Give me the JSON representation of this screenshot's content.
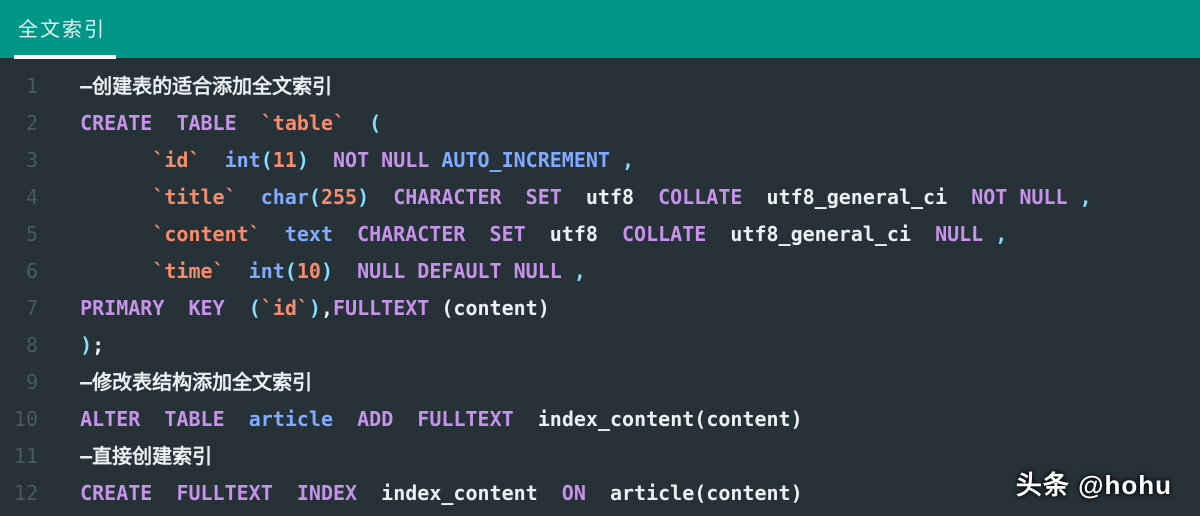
{
  "header": {
    "tab_label": "全文索引"
  },
  "editor": {
    "lines": [
      {
        "num": "1",
        "tokens": [
          [
            "white",
            "  –创建表的适合添加全文索引"
          ]
        ]
      },
      {
        "num": "2",
        "tokens": [
          [
            "white",
            "  "
          ],
          [
            "kw",
            "CREATE"
          ],
          [
            "white",
            "  "
          ],
          [
            "kw",
            "TABLE"
          ],
          [
            "white",
            "  "
          ],
          [
            "str",
            "`table`"
          ],
          [
            "white",
            "  "
          ],
          [
            "punct",
            "("
          ]
        ]
      },
      {
        "num": "3",
        "tokens": [
          [
            "white",
            "        "
          ],
          [
            "str",
            "`id`"
          ],
          [
            "white",
            "  "
          ],
          [
            "type",
            "int"
          ],
          [
            "punct",
            "("
          ],
          [
            "num",
            "11"
          ],
          [
            "punct",
            ")"
          ],
          [
            "white",
            "  "
          ],
          [
            "kw",
            "NOT"
          ],
          [
            "white",
            " "
          ],
          [
            "kw",
            "NULL"
          ],
          [
            "white",
            " "
          ],
          [
            "ident",
            "AUTO_INCREMENT"
          ],
          [
            "white",
            " "
          ],
          [
            "punct",
            ","
          ]
        ]
      },
      {
        "num": "4",
        "tokens": [
          [
            "white",
            "        "
          ],
          [
            "str",
            "`title`"
          ],
          [
            "white",
            "  "
          ],
          [
            "type",
            "char"
          ],
          [
            "punct",
            "("
          ],
          [
            "num",
            "255"
          ],
          [
            "punct",
            ")"
          ],
          [
            "white",
            "  "
          ],
          [
            "kw",
            "CHARACTER"
          ],
          [
            "white",
            "  "
          ],
          [
            "kw",
            "SET"
          ],
          [
            "white",
            "  "
          ],
          [
            "white",
            "utf8  "
          ],
          [
            "kw",
            "COLLATE"
          ],
          [
            "white",
            "  utf8_general_ci  "
          ],
          [
            "kw",
            "NOT"
          ],
          [
            "white",
            " "
          ],
          [
            "kw",
            "NULL"
          ],
          [
            "white",
            " "
          ],
          [
            "punct",
            ","
          ]
        ]
      },
      {
        "num": "5",
        "tokens": [
          [
            "white",
            "        "
          ],
          [
            "str",
            "`content`"
          ],
          [
            "white",
            "  "
          ],
          [
            "type",
            "text"
          ],
          [
            "white",
            "  "
          ],
          [
            "kw",
            "CHARACTER"
          ],
          [
            "white",
            "  "
          ],
          [
            "kw",
            "SET"
          ],
          [
            "white",
            "  utf8  "
          ],
          [
            "kw",
            "COLLATE"
          ],
          [
            "white",
            "  utf8_general_ci  "
          ],
          [
            "kw",
            "NULL"
          ],
          [
            "white",
            " "
          ],
          [
            "punct",
            ","
          ]
        ]
      },
      {
        "num": "6",
        "tokens": [
          [
            "white",
            "        "
          ],
          [
            "str",
            "`time`"
          ],
          [
            "white",
            "  "
          ],
          [
            "type",
            "int"
          ],
          [
            "punct",
            "("
          ],
          [
            "num",
            "10"
          ],
          [
            "punct",
            ")"
          ],
          [
            "white",
            "  "
          ],
          [
            "kw",
            "NULL"
          ],
          [
            "white",
            " "
          ],
          [
            "kw",
            "DEFAULT"
          ],
          [
            "white",
            " "
          ],
          [
            "kw",
            "NULL"
          ],
          [
            "white",
            " "
          ],
          [
            "punct",
            ","
          ]
        ]
      },
      {
        "num": "7",
        "tokens": [
          [
            "white",
            "  "
          ],
          [
            "kw",
            "PRIMARY"
          ],
          [
            "white",
            "  "
          ],
          [
            "kw",
            "KEY"
          ],
          [
            "white",
            "  "
          ],
          [
            "punct",
            "("
          ],
          [
            "str",
            "`id`"
          ],
          [
            "punct",
            ")"
          ],
          [
            "white",
            ","
          ],
          [
            "kw",
            "FULLTEXT"
          ],
          [
            "white",
            " (content)"
          ]
        ]
      },
      {
        "num": "8",
        "tokens": [
          [
            "white",
            "  "
          ],
          [
            "punct",
            ")"
          ],
          [
            "white",
            ";"
          ]
        ]
      },
      {
        "num": "9",
        "tokens": [
          [
            "white",
            "  –修改表结构添加全文索引"
          ]
        ]
      },
      {
        "num": "10",
        "tokens": [
          [
            "white",
            "  "
          ],
          [
            "kw",
            "ALTER"
          ],
          [
            "white",
            "  "
          ],
          [
            "kw",
            "TABLE"
          ],
          [
            "white",
            "  "
          ],
          [
            "ident",
            "article"
          ],
          [
            "white",
            "  "
          ],
          [
            "kw",
            "ADD"
          ],
          [
            "white",
            "  "
          ],
          [
            "kw",
            "FULLTEXT"
          ],
          [
            "white",
            "  index_content(content)"
          ]
        ]
      },
      {
        "num": "11",
        "tokens": [
          [
            "white",
            "  –直接创建索引"
          ]
        ]
      },
      {
        "num": "12",
        "tokens": [
          [
            "white",
            "  "
          ],
          [
            "kw",
            "CREATE"
          ],
          [
            "white",
            "  "
          ],
          [
            "kw",
            "FULLTEXT"
          ],
          [
            "white",
            "  "
          ],
          [
            "kw",
            "INDEX"
          ],
          [
            "white",
            "  index_content  "
          ],
          [
            "kw",
            "ON"
          ],
          [
            "white",
            "  article(content)"
          ]
        ]
      }
    ]
  },
  "watermark": "头条 @hohu"
}
